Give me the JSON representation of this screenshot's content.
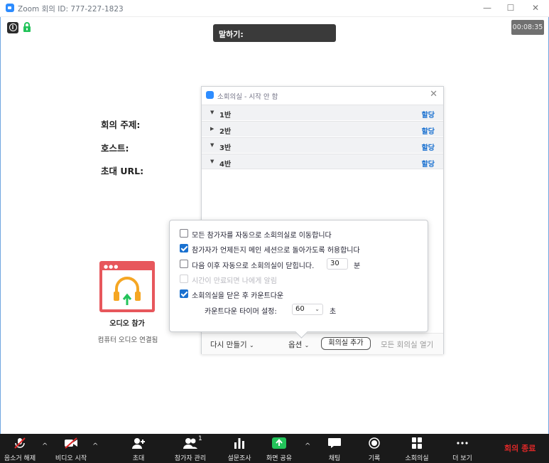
{
  "window": {
    "title": "Zoom 회의 ID: 777-227-1823",
    "minimize": "—",
    "maximize": "☐",
    "close": "✕"
  },
  "top": {
    "speaking_label": "말하기:",
    "timer": "00:08:35"
  },
  "meeting_info": {
    "topic_label": "회의 주제:",
    "host_label": "호스트:",
    "invite_url_label": "초대 URL:"
  },
  "audio": {
    "join_label": "오디오 참가",
    "computer_audio": "컴퓨터 오디오 연결됨"
  },
  "breakout": {
    "title": "소회의실 - 시작 안 함",
    "rooms": [
      {
        "name": "1반",
        "action": "할당"
      },
      {
        "name": "2반",
        "action": "할당"
      },
      {
        "name": "3반",
        "action": "할당"
      },
      {
        "name": "4반",
        "action": "할당"
      }
    ],
    "footer": {
      "recreate": "다시 만들기",
      "options": "옵션",
      "add_room": "회의실 추가",
      "open_all": "모든 회의실 열기"
    }
  },
  "options": {
    "items": [
      {
        "label": "모든 참가자를 자동으로 소회의실로 이동합니다",
        "checked": false,
        "disabled": false
      },
      {
        "label": "참가자가 언제든지 메인 세션으로 돌아가도록 허용합니다",
        "checked": true,
        "disabled": false
      },
      {
        "label": "다음 이후 자동으로 소회의실이 닫힙니다.",
        "checked": false,
        "disabled": false
      },
      {
        "label": "시간이 만료되면 나에게 알림",
        "checked": false,
        "disabled": true
      },
      {
        "label": "소회의실을 닫은 후 카운트다운",
        "checked": true,
        "disabled": false
      }
    ],
    "auto_close_minutes": "30",
    "minutes_unit": "분",
    "countdown_label": "카운트다운 타이머 설정:",
    "countdown_value": "60",
    "seconds_unit": "초"
  },
  "toolbar": {
    "mute": "음소거 해제",
    "video": "비디오 시작",
    "invite": "초대",
    "participants": "참가자 관리",
    "participants_count": "1",
    "polling": "설문조사",
    "share": "화면 공유",
    "chat": "채팅",
    "record": "기록",
    "breakout": "소회의실",
    "more": "더 보기",
    "end": "회의 종료"
  },
  "colors": {
    "accent": "#1a71d0",
    "share_green": "#23c35a",
    "end_red": "#e02828",
    "audio_card": "#e7575c",
    "headphone_orange": "#f5a623"
  }
}
